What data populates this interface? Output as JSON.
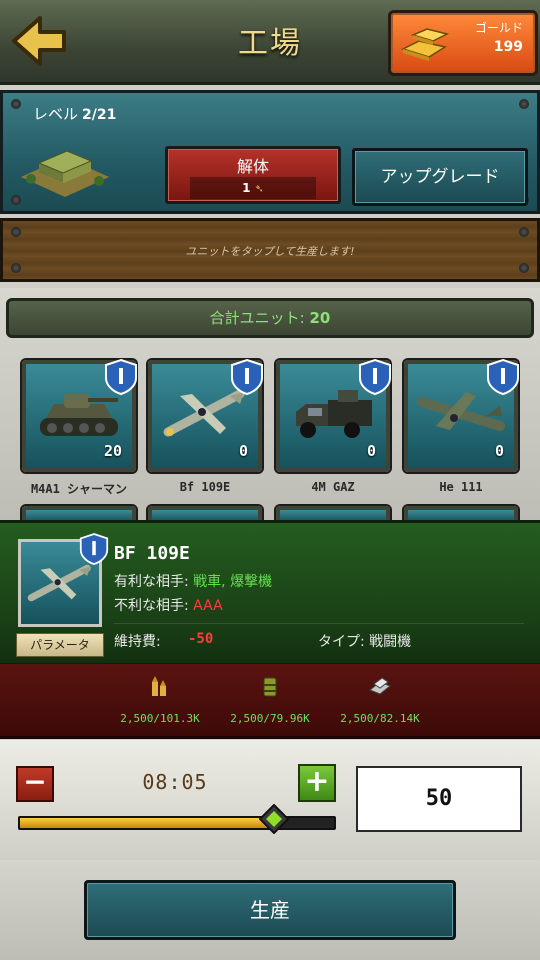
{
  "header": {
    "title": "工場",
    "gold_label": "ゴールド",
    "gold_value": "199"
  },
  "level": {
    "label": "レベル",
    "value": "2/21"
  },
  "dismantle": {
    "label": "解体",
    "cost": "1"
  },
  "upgrade": {
    "label": "アップグレード"
  },
  "hint": "ユニットをタップして生産します!",
  "units": {
    "total_label": "合計ユニット:",
    "total_value": "20",
    "items": [
      {
        "name": "M4A1 シャーマン",
        "count": "20",
        "rank": "I",
        "icon": "tank-icon"
      },
      {
        "name": "Bf 109E",
        "count": "0",
        "rank": "I",
        "icon": "fighter-plane-icon"
      },
      {
        "name": "4M GAZ",
        "count": "0",
        "rank": "I",
        "icon": "truck-icon"
      },
      {
        "name": "He 111",
        "count": "0",
        "rank": "I",
        "icon": "bomber-plane-icon"
      }
    ]
  },
  "detail": {
    "name": "BF 109E",
    "rank": "I",
    "strong_label": "有利な相手:",
    "strong_value": "戦車, 爆撃機",
    "weak_label": "不利な相手:",
    "weak_value": "AAA",
    "param_button": "パラメータ",
    "upkeep_label": "維持費:",
    "upkeep_value": "-50",
    "type_label": "タイプ:",
    "type_value": "戦闘機"
  },
  "resources": [
    {
      "icon": "ammo-icon",
      "value": "2,500/101.3K"
    },
    {
      "icon": "fuel-barrel-icon",
      "value": "2,500/79.96K"
    },
    {
      "icon": "steel-icon",
      "value": "2,500/82.14K"
    }
  ],
  "production": {
    "time": "08:05",
    "quantity": "50",
    "slider_fraction": 0.81,
    "minus": "−",
    "plus": "+"
  },
  "produce_button": "生産",
  "colors": {
    "accent_teal": "#235a64",
    "gold": "#d84a12",
    "good": "#62e04a",
    "bad": "#ff3b3b",
    "slider": "#ffce3a"
  }
}
